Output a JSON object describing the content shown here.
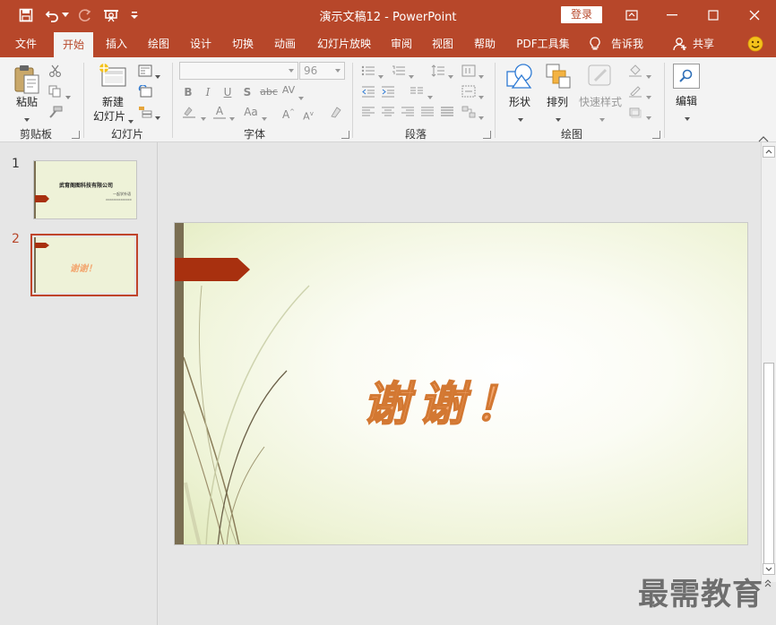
{
  "window": {
    "title": "演示文稿12  -  PowerPoint",
    "login_label": "登录"
  },
  "tabs": [
    {
      "label": "文件"
    },
    {
      "label": "开始"
    },
    {
      "label": "插入"
    },
    {
      "label": "绘图"
    },
    {
      "label": "设计"
    },
    {
      "label": "切换"
    },
    {
      "label": "动画"
    },
    {
      "label": "幻灯片放映"
    },
    {
      "label": "审阅"
    },
    {
      "label": "视图"
    },
    {
      "label": "帮助"
    },
    {
      "label": "PDF工具集"
    }
  ],
  "tell_me": "告诉我",
  "share": "共享",
  "ribbon": {
    "clipboard": {
      "paste_label": "粘贴",
      "group_label": "剪贴板"
    },
    "slides": {
      "new_slide_line1": "新建",
      "new_slide_line2": "幻灯片",
      "group_label": "幻灯片"
    },
    "font": {
      "font_name": "",
      "font_size": "96",
      "group_label": "字体"
    },
    "paragraph": {
      "group_label": "段落"
    },
    "drawing": {
      "shapes_label": "形状",
      "arrange_label": "排列",
      "quick_styles_label": "快速样式",
      "group_label": "绘图"
    },
    "editing": {
      "edit_label": "编辑"
    }
  },
  "thumbnails": [
    {
      "number": "1",
      "title_text": "武育阁图科技有限公司",
      "sub_text": "一起学外语",
      "sub_text2": "XXXXXXXXXXXXXX"
    },
    {
      "number": "2",
      "text": "谢谢！"
    }
  ],
  "slide": {
    "text": "谢谢！"
  },
  "watermark": "最需教育",
  "colors": {
    "accent": "#b7472a",
    "banner": "#a8300f",
    "thanks_fill": "#f3a770",
    "thanks_stroke": "#d37832"
  }
}
